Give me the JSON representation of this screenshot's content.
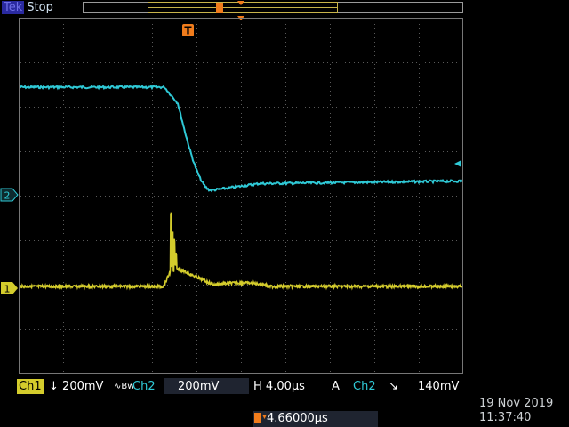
{
  "header": {
    "brand": "Tek",
    "acq_state": "Stop"
  },
  "trigger_marker": "T",
  "channels": {
    "ch1": {
      "marker": "1",
      "label": "Ch1",
      "coupling": "↓",
      "scale": "200mV",
      "bw_limit": "∿Bw",
      "color": "#d4cc2c"
    },
    "ch2": {
      "marker": "2",
      "label": "Ch2",
      "scale": "200mV",
      "color": "#2fc9d6"
    }
  },
  "horizontal": {
    "label": "H",
    "scale": "4.00µs"
  },
  "trigger": {
    "mode": "A",
    "source": "Ch2",
    "slope": "↘",
    "level": "140mV"
  },
  "trigger_position": "4.66000µs",
  "date": "19 Nov 2019",
  "time": "11:37:40",
  "colors": {
    "background": "#000000",
    "grid": "#6a6a6a",
    "trigger_marker": "#f07c1c"
  }
}
